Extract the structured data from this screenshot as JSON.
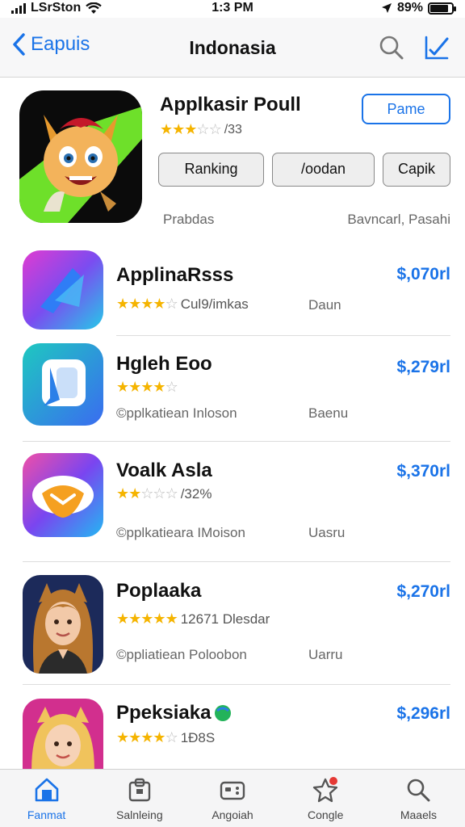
{
  "status": {
    "carrier": "LSrSton",
    "time": "1:3 PM",
    "battery": "89%"
  },
  "nav": {
    "back_label": "Eapuis",
    "title": "Indonasia"
  },
  "featured": {
    "name": "Applkasir Poull",
    "rating_text": "/33",
    "stars": 3,
    "get_label": "Pame",
    "chips": [
      "Ranking",
      "/oodan",
      "Capik"
    ],
    "sub_left": "Prabdas",
    "sub_right": "Bavncarl, Pasahi"
  },
  "apps": [
    {
      "name": "ApplinaRsss",
      "stars": 4,
      "rating_text": "Cul9/imkas",
      "sub": "",
      "tag": "Daun",
      "price": "$,070rl"
    },
    {
      "name": "Hgleh Eoo",
      "stars": 4,
      "rating_text": "",
      "sub": "©pplkatiean Inloson",
      "tag": "Baenu",
      "price": "$,279rl"
    },
    {
      "name": "Voalk Asla",
      "stars": 2,
      "rating_text": "/32%",
      "sub": "©pplkatieara IMoison",
      "tag": "Uasru",
      "price": "$,370rl"
    },
    {
      "name": "Poplaaka",
      "stars": 5,
      "rating_text": "12671 Dlesdar",
      "sub": "©ppliatiean Poloobon",
      "tag": "Uarru",
      "price": "$,270rl"
    },
    {
      "name": "Ppeksiaka",
      "stars": 4,
      "rating_text": "1Ð8S",
      "sub": "",
      "tag": "",
      "price": "$,296rl"
    }
  ],
  "tabs": [
    {
      "label": "Fanmat",
      "icon": "home-icon"
    },
    {
      "label": "Salnleing",
      "icon": "store-icon"
    },
    {
      "label": "Angoiah",
      "icon": "gamepad-icon"
    },
    {
      "label": "Congle",
      "icon": "star-badge-icon"
    },
    {
      "label": "Maaels",
      "icon": "search-icon"
    }
  ],
  "colors": {
    "accent": "#1a73e8",
    "star": "#f5b400"
  }
}
